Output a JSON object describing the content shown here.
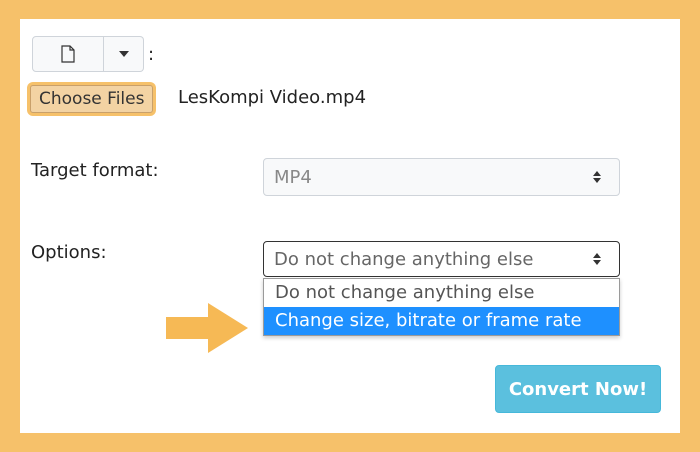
{
  "file_input": {
    "choose_label": "Choose Files",
    "file_name": "LesKompi Video.mp4",
    "separator": ":"
  },
  "target_format": {
    "label": "Target format:",
    "selected": "MP4"
  },
  "options": {
    "label": "Options:",
    "selected": "Do not change anything else",
    "dropdown_items": [
      "Do not change anything else",
      "Change size, bitrate or frame rate"
    ],
    "highlighted_index": 1
  },
  "convert": {
    "label": "Convert Now!"
  },
  "colors": {
    "frame_border": "#f6c16a",
    "highlight": "#1e90ff",
    "convert_button": "#5bc0de",
    "arrow": "#f6b955"
  },
  "icons": {
    "file": "file-icon",
    "dropdown": "caret-down-icon",
    "select": "updown-icon",
    "pointer": "arrow-right-icon"
  }
}
